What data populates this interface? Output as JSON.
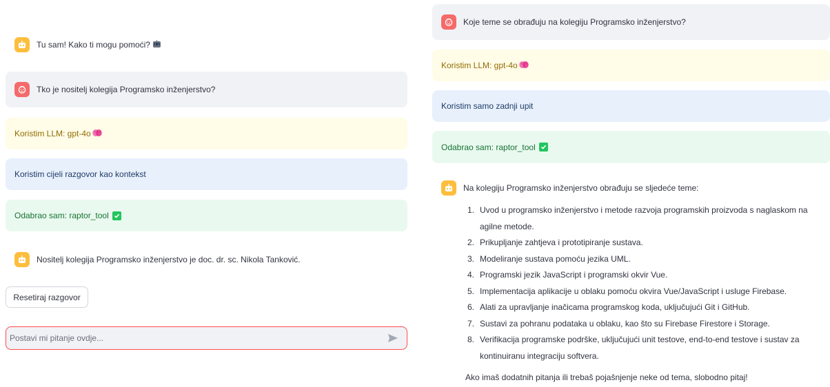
{
  "left": {
    "messages": [
      {
        "role": "assistant",
        "text": "Tu sam! Kako ti mogu pomoći?",
        "emoji": "robot"
      },
      {
        "role": "user",
        "text": "Tko je nositelj kolegija Programsko inženjerstvo?"
      },
      {
        "role": "status_llm",
        "text": "Koristim LLM: gpt-4o"
      },
      {
        "role": "status_context",
        "text": "Koristim cijeli razgovor kao kontekst"
      },
      {
        "role": "status_tool",
        "text": "Odabrao sam: raptor_tool"
      },
      {
        "role": "assistant",
        "text": "Nositelj kolegija Programsko inženjerstvo je doc. dr. sc. Nikola Tanković."
      }
    ],
    "reset_label": "Resetiraj razgovor",
    "input_placeholder": "Postavi mi pitanje ovdje..."
  },
  "right": {
    "messages": [
      {
        "role": "user",
        "text": "Koje teme se obrađuju na kolegiju Programsko inženjerstvo?"
      },
      {
        "role": "status_llm",
        "text": "Koristim LLM: gpt-4o"
      },
      {
        "role": "status_context",
        "text": "Koristim samo zadnji upit"
      },
      {
        "role": "status_tool",
        "text": "Odabrao sam: raptor_tool"
      }
    ],
    "answer": {
      "intro": "Na kolegiju Programsko inženjerstvo obrađuju se sljedeće teme:",
      "items": [
        {
          "num": "1.",
          "lines": [
            "Uvod u programsko inženjerstvo i metode razvoja programskih proizvoda s naglaskom na",
            "agilne metode."
          ]
        },
        {
          "num": "2.",
          "lines": [
            "Prikupljanje zahtjeva i prototipiranje sustava."
          ]
        },
        {
          "num": "3.",
          "lines": [
            "Modeliranje sustava pomoću jezika UML."
          ]
        },
        {
          "num": "4.",
          "lines": [
            "Programski jezik JavaScript i programski okvir Vue."
          ]
        },
        {
          "num": "5.",
          "lines": [
            "Implementacija aplikacije u oblaku pomoću okvira Vue/JavaScript i usluge Firebase."
          ]
        },
        {
          "num": "6.",
          "lines": [
            "Alati za upravljanje inačicama programskog koda, uključujući Git i GitHub."
          ]
        },
        {
          "num": "7.",
          "lines": [
            "Sustavi za pohranu podataka u oblaku, kao što su Firebase Firestore i Storage."
          ]
        },
        {
          "num": "8.",
          "lines": [
            "Verifikacija programske podrške, uključujući unit testove, end-to-end testove i sustav za",
            "kontinuiranu integraciju softvera."
          ]
        }
      ],
      "closing": "Ako imaš dodatnih pitanja ili trebaš pojašnjenje neke od tema, slobodno pitaj!"
    }
  },
  "colors": {
    "accent": "#ff4b4b",
    "bot_avatar": "#fdbe3d",
    "user_avatar": "#f56a6a",
    "warning_bg": "#fffce7",
    "info_bg": "#e8f0fc",
    "success_bg": "#e9f9ef"
  }
}
